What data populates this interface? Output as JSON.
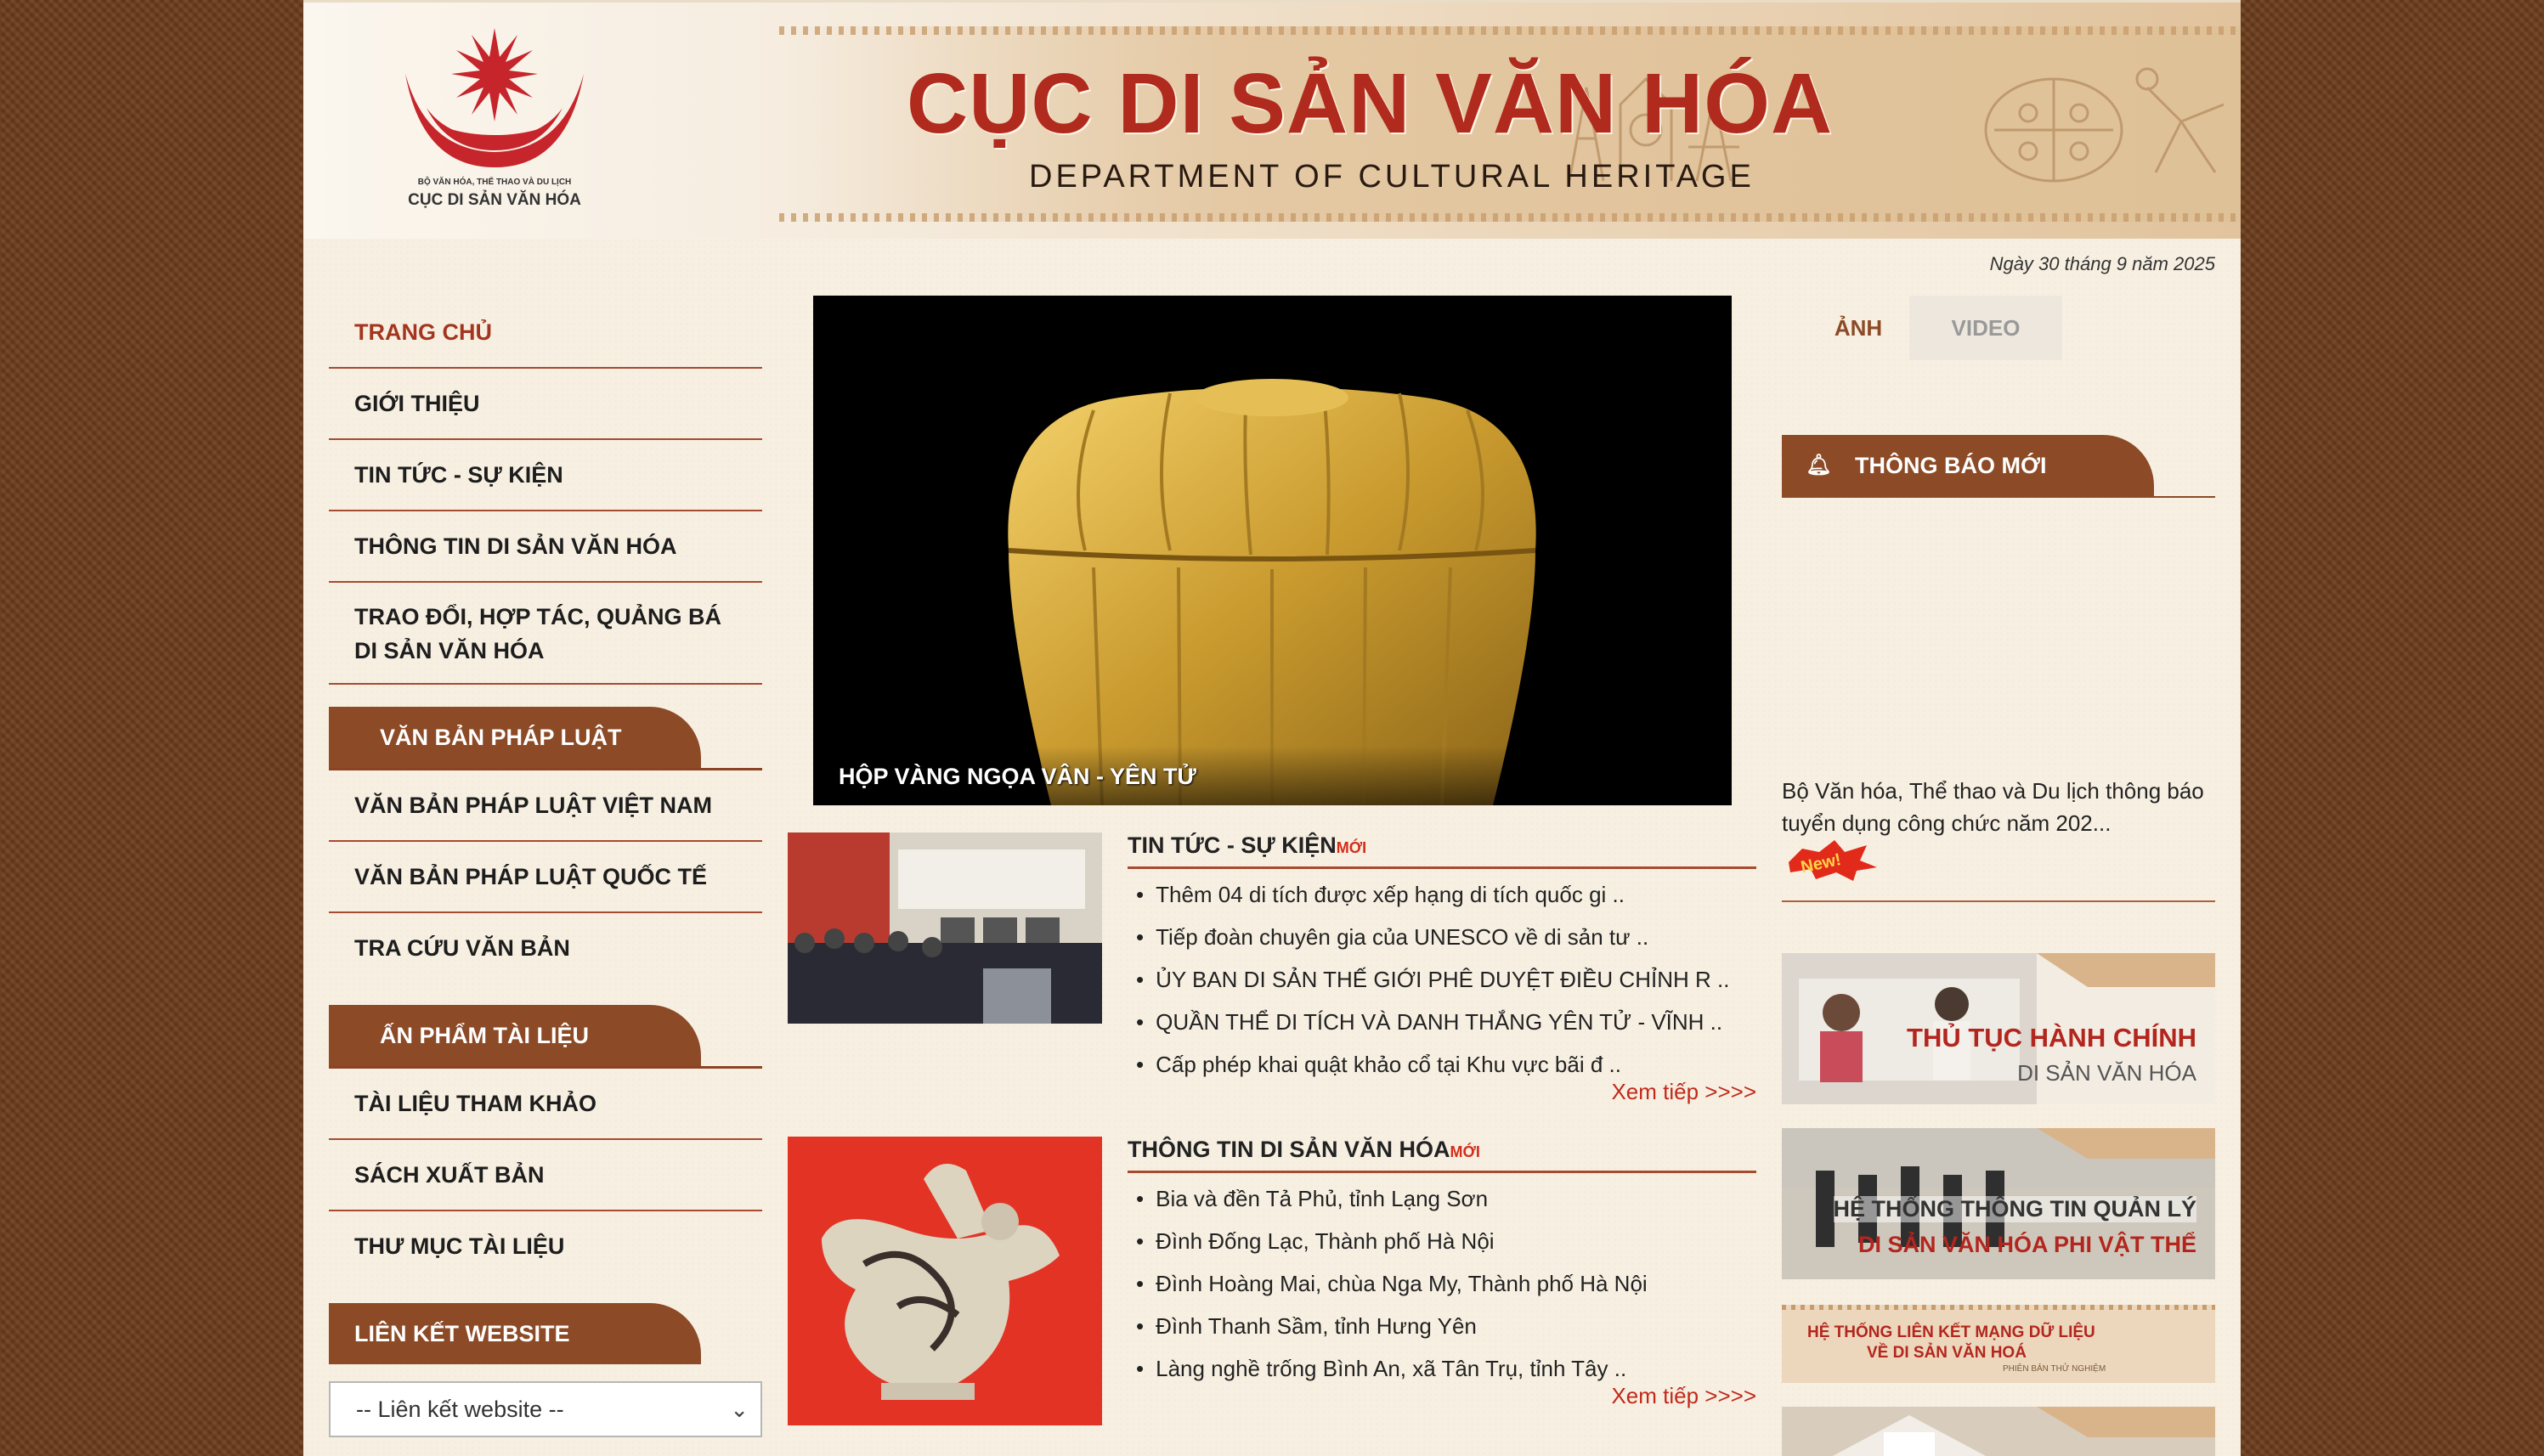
{
  "header": {
    "logo_line1": "BỘ VĂN HÓA, THỂ THAO VÀ DU LỊCH",
    "logo_line2": "CỤC DI SẢN VĂN HÓA",
    "title": "CỤC DI SẢN VĂN HÓA",
    "subtitle": "DEPARTMENT OF CULTURAL HERITAGE"
  },
  "date": "Ngày 30 tháng 9 năm 2025",
  "nav": {
    "items": [
      {
        "label": "TRANG CHỦ"
      },
      {
        "label": "GIỚI THIỆU"
      },
      {
        "label": "TIN TỨC - SỰ KIỆN"
      },
      {
        "label": "THÔNG TIN DI SẢN VĂN HÓA"
      },
      {
        "label": "TRAO ĐỔI, HỢP TÁC, QUẢNG BÁ DI SẢN VĂN HÓA"
      }
    ],
    "legal_title": "VĂN BẢN PHÁP LUẬT",
    "legal_items": [
      {
        "label": "VĂN BẢN PHÁP LUẬT VIỆT NAM"
      },
      {
        "label": "VĂN BẢN PHÁP LUẬT QUỐC TẾ"
      },
      {
        "label": "TRA CỨU VĂN BẢN"
      }
    ],
    "pub_title": "ẤN PHẨM TÀI LIỆU",
    "pub_items": [
      {
        "label": "TÀI LIỆU THAM KHẢO"
      },
      {
        "label": "SÁCH XUẤT BẢN"
      },
      {
        "label": "THƯ MỤC TÀI LIỆU"
      }
    ],
    "links_title": "LIÊN KẾT WEBSITE",
    "links_select": "-- Liên kết website --"
  },
  "featured": {
    "caption": "HỘP VÀNG NGỌA VÂN - YÊN TỬ"
  },
  "news": {
    "title": "TIN TỨC - SỰ KIỆN",
    "new_tag": "MỚI",
    "items": [
      "Thêm 04 di tích được xếp hạng di tích quốc gi ..",
      "Tiếp đoàn chuyên gia của UNESCO về di sản tư ..",
      "ỦY BAN DI SẢN THẾ GIỚI PHÊ DUYỆT ĐIỀU CHỈNH R ..",
      "QUẦN THỂ DI TÍCH VÀ DANH THẮNG YÊN TỬ - VĨNH ..",
      "Cấp phép khai quật khảo cổ tại Khu vực bãi đ .."
    ],
    "more": "Xem tiếp >>>>"
  },
  "heritage": {
    "title": "THÔNG TIN DI SẢN VĂN HÓA",
    "new_tag": "MỚI",
    "items": [
      "Bia và đền Tả Phủ, tỉnh Lạng Sơn",
      "Đình Đống Lạc, Thành phố Hà Nội",
      "Đình Hoàng Mai, chùa Nga My, Thành phố Hà Nội",
      "Đình Thanh Sầm, tỉnh Hưng Yên",
      "Làng nghề trống Bình An, xã Tân Trụ, tỉnh Tây .."
    ],
    "more": "Xem tiếp >>>>"
  },
  "media": {
    "photo_tab": "ẢNH",
    "video_tab": "VIDEO"
  },
  "notice": {
    "title": "THÔNG BÁO MỚI",
    "text": "Bộ Văn hóa, Thể thao và Du lịch thông báo tuyển dụng công chức năm 202...",
    "badge": "New!"
  },
  "banners": {
    "b1_line1": "THỦ TỤC HÀNH CHÍNH",
    "b1_line2": "DI SẢN VĂN HÓA",
    "b2_line1": "HỆ THỐNG THÔNG TIN QUẢN LÝ",
    "b2_line2": "DI SẢN VĂN HÓA PHI VẬT THỂ",
    "b3_line1": "HỆ THỐNG LIÊN KẾT MẠNG DỮ LIỆU",
    "b3_line2": "VỀ DI SẢN VĂN HOÁ",
    "b3_line3": "PHIÊN BẢN THỬ NGHIỆM"
  },
  "colors": {
    "brand_red": "#b02a1d",
    "brown": "#8c4a26",
    "link_red": "#c1291b"
  }
}
